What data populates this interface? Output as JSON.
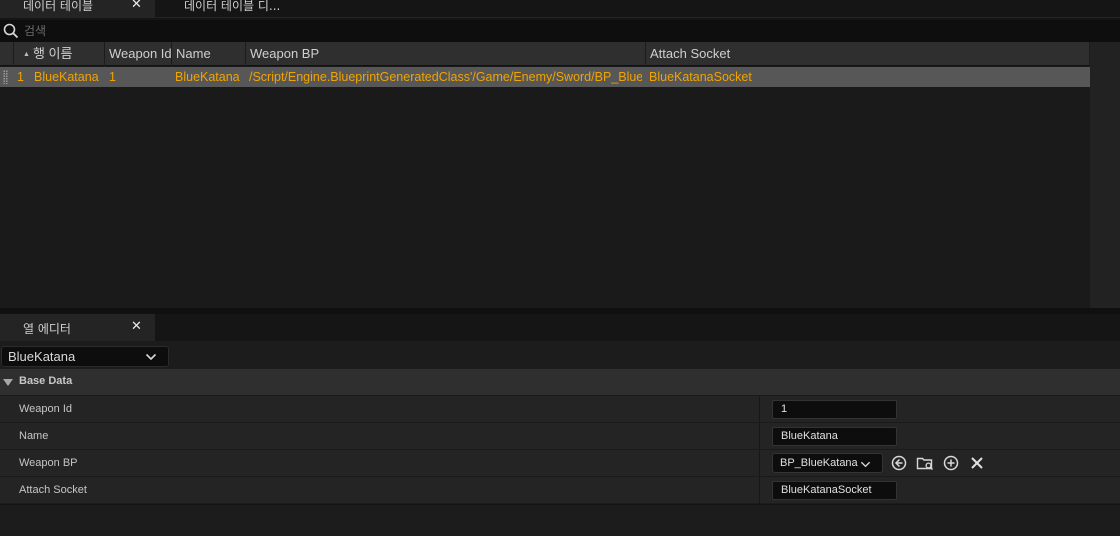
{
  "tabs": [
    {
      "label": "데이터 테이블",
      "active": true
    },
    {
      "label": "데이터 테이블 디...",
      "active": false
    }
  ],
  "search": {
    "placeholder": "검색"
  },
  "table": {
    "columns": [
      "행 이름",
      "Weapon Id",
      "Name",
      "Weapon BP",
      "Attach Socket"
    ],
    "rows": [
      {
        "index": "1",
        "row_name": "BlueKatana",
        "weapon_id": "1",
        "name": "BlueKatana",
        "weapon_bp": "/Script/Engine.BlueprintGeneratedClass'/Game/Enemy/Sword/BP_BlueK",
        "attach_socket": "BlueKatanaSocket"
      }
    ]
  },
  "row_editor": {
    "tab_label": "열 에디터",
    "selected_row": "BlueKatana",
    "category": "Base Data",
    "properties": {
      "weapon_id": {
        "label": "Weapon Id",
        "value": "1"
      },
      "name": {
        "label": "Name",
        "value": "BlueKatana"
      },
      "weapon_bp": {
        "label": "Weapon BP",
        "value": "BP_BlueKatana"
      },
      "attach_socket": {
        "label": "Attach Socket",
        "value": "BlueKatanaSocket"
      }
    }
  },
  "icons": [
    "search-icon",
    "sort-ascending-icon",
    "chevron-down-icon",
    "use-selected-asset-icon",
    "browse-folder-icon",
    "add-circle-icon",
    "clear-x-icon",
    "close-icon"
  ],
  "colors": {
    "highlight_text": "#f0a400",
    "selected_row_bg": "#575757",
    "panel_bg": "#242424"
  }
}
